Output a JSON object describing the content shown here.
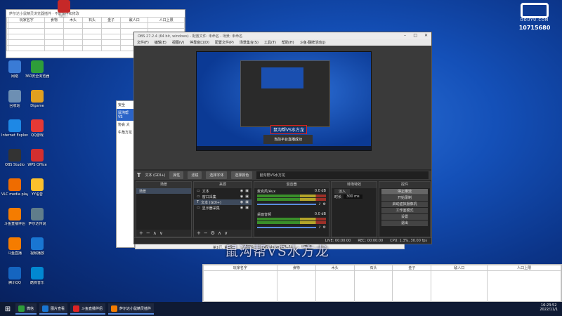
{
  "colors": {
    "desktop_bg": "#1450b8",
    "obs_dark": "#2b2b2b",
    "accent_red": "#e02424"
  },
  "brand": {
    "text": "DOUYU.COM",
    "room_number": "10715680"
  },
  "desktop_icons": [
    {
      "label": "Wo...",
      "icon": "app-red-icon"
    },
    {
      "label": "网络",
      "icon": "network-icon"
    },
    {
      "label": "360安全浏览器",
      "icon": "browser-360-icon"
    },
    {
      "label": "回收站",
      "icon": "recycle-bin-icon"
    },
    {
      "label": "Digame",
      "icon": "game-icon"
    },
    {
      "label": "Internet Explorer",
      "icon": "ie-icon"
    },
    {
      "label": "QQ游戏",
      "icon": "qq-game-icon"
    },
    {
      "label": "OBS Studio",
      "icon": "obs-icon"
    },
    {
      "label": "WPS Office",
      "icon": "wps-icon"
    },
    {
      "label": "VLC media player",
      "icon": "vlc-icon"
    },
    {
      "label": "YY语音",
      "icon": "yy-icon"
    },
    {
      "label": "斗鱼直播伴侣",
      "icon": "douyu-companion-icon"
    },
    {
      "label": "萨尔达传说",
      "icon": "doc-icon"
    },
    {
      "label": "斗鱼直播",
      "icon": "douyu-live-icon"
    },
    {
      "label": "视频播放",
      "icon": "video-icon"
    },
    {
      "label": "腾讯QQ",
      "icon": "qq-icon"
    },
    {
      "label": "酷狗音乐",
      "icon": "kugou-icon"
    }
  ],
  "sheet_top": {
    "title": "萨尔达小鼠精灵浏览器插件 · 不能保存和修改",
    "headers": [
      "",
      "玩家名字",
      "食物",
      "木头",
      "石头",
      "金子",
      "敌人口",
      "人口上限"
    ]
  },
  "sheet_bottom": {
    "headers": [
      "玩家名字",
      "食物",
      "木头",
      "石头",
      "金子",
      "敌人口",
      "人口上限"
    ]
  },
  "side_window": {
    "lines": [
      "安全",
      "鼠沟帮VS",
      "协会 大",
      "牛角方龙"
    ],
    "status_left": "第1行, 第1列",
    "status_mid": "100%",
    "status_right": "Windows (CRLF)",
    "encoding": "UTF-8"
  },
  "obs": {
    "title": "OBS 27.2.4 (64 bit, windows) - 配置文件: 未命名 - 场景: 未命名",
    "menu": [
      "文件(F)",
      "编辑(E)",
      "视图(V)",
      "停靠窗口(D)",
      "配置文件(P)",
      "场景集合(S)",
      "工具(T)",
      "帮助(H)",
      "斗鱼·翻牌活动(J)"
    ],
    "source_label": "文本 (GDI+)",
    "btn_properties": "属性",
    "btn_filters": "滤镜",
    "btn_select_font": "选择字体",
    "btn_text_color": "选择颜色",
    "text_field": "鼠沟帮VS水方龙",
    "docks": {
      "scenes": {
        "title": "场景",
        "items": [
          "场景"
        ]
      },
      "sources": {
        "title": "来源",
        "items": [
          "文本",
          "窗口采集",
          "文本 (GDI+)",
          "显示器采集"
        ]
      },
      "mixer": {
        "title": "混音器",
        "channels": [
          {
            "name": "麦克风/Aux",
            "db": "0.0 dB"
          },
          {
            "name": "桌面音频",
            "db": "0.0 dB"
          }
        ]
      },
      "transitions": {
        "title": "转场特效",
        "mode": "淡入",
        "duration_label": "时长",
        "duration": "300 ms"
      },
      "controls": {
        "title": "控件",
        "buttons": [
          "停止推流",
          "开始录制",
          "启动虚拟摄像机",
          "工作室模式",
          "设置",
          "退出"
        ]
      }
    },
    "status": {
      "live": "LIVE: 00:00:00",
      "rec": "REC: 00:00:00",
      "cpu": "CPU: 1.3%, 30.00 fps"
    },
    "canvas_overlay": "鼠沟帮VS水方龙",
    "canvas_dialog": "当前平台直播成功"
  },
  "overlay_title": "鼠沟帮VS水方龙",
  "taskbar": {
    "items": [
      "微信",
      "图片查看",
      "斗鱼直播伴侣",
      "萨尔达小鼠精灵插件"
    ],
    "time": "16:23:52",
    "date": "2022/11/1"
  }
}
